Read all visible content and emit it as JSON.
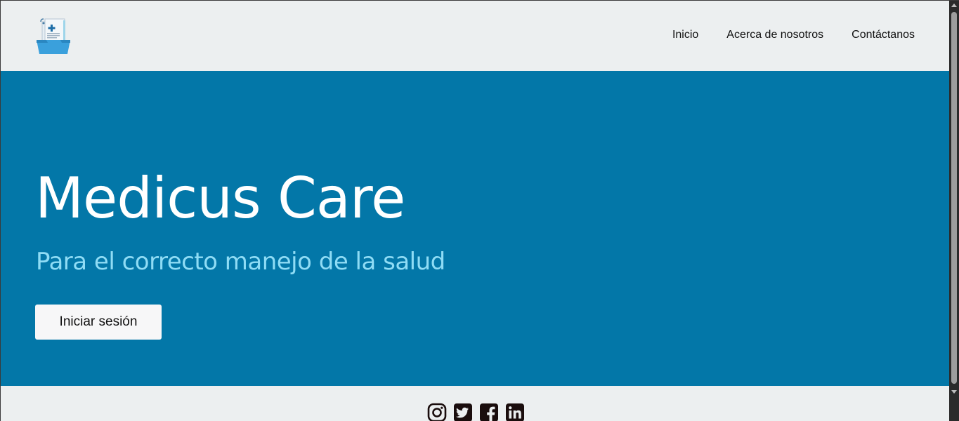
{
  "header": {
    "logo_icon": "medical-folder-icon",
    "nav": [
      {
        "label": "Inicio"
      },
      {
        "label": "Acerca de nosotros"
      },
      {
        "label": "Contáctanos"
      }
    ]
  },
  "hero": {
    "title": "Medicus Care",
    "subtitle": "Para el correcto manejo de la salud",
    "login_label": "Iniciar sesión"
  },
  "footer": {
    "social_icons": [
      "instagram-icon",
      "twitter-icon",
      "facebook-icon",
      "linkedin-icon"
    ]
  },
  "colors": {
    "header_bg": "#eceff0",
    "hero_bg": "#0377a8",
    "title": "#ffffff",
    "subtitle": "#8fdcf5",
    "button_bg": "#f7f7f8",
    "social_icon": "#1a0d0d"
  }
}
